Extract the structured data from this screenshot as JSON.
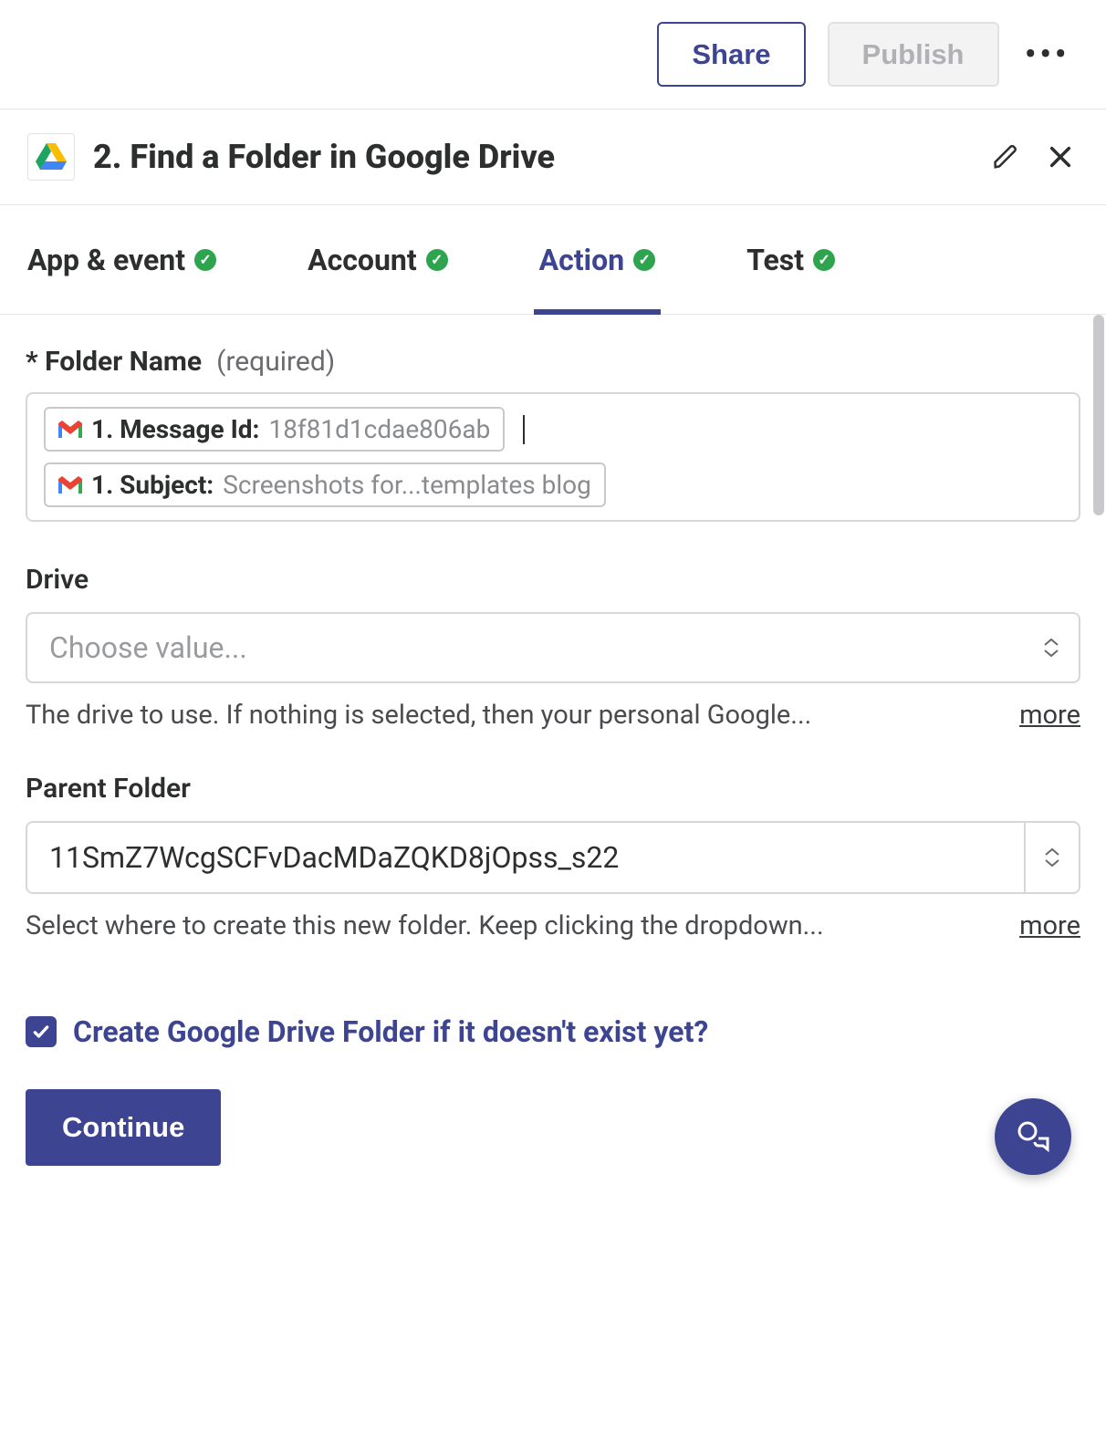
{
  "header": {
    "share_label": "Share",
    "publish_label": "Publish"
  },
  "step": {
    "title": "2. Find a Folder in Google Drive"
  },
  "tabs": {
    "app": "App & event",
    "account": "Account",
    "action": "Action",
    "test": "Test"
  },
  "folder_name": {
    "label": "Folder Name",
    "asterisk": "*",
    "required_hint": "(required)",
    "pill1_prefix": "1. Message Id:",
    "pill1_value": "18f81d1cdae806ab",
    "pill2_prefix": "1. Subject:",
    "pill2_value": "Screenshots for...templates blog"
  },
  "drive": {
    "label": "Drive",
    "placeholder": "Choose value...",
    "help": "The drive to use. If nothing is selected, then your personal Google...",
    "more": "more"
  },
  "parent": {
    "label": "Parent Folder",
    "value": "11SmZ7WcgSCFvDacMDaZQKD8jOpss_s22",
    "help": "Select where to create this new folder. Keep clicking the dropdown...",
    "more": "more"
  },
  "create_checkbox": {
    "label": "Create Google Drive Folder if it doesn't exist yet?"
  },
  "footer": {
    "continue_label": "Continue"
  }
}
